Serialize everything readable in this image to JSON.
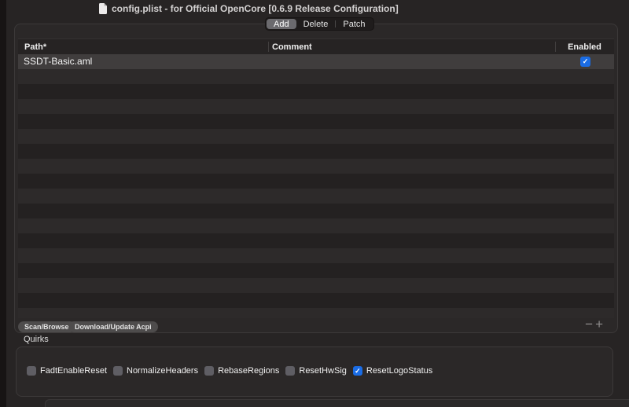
{
  "window": {
    "title": "config.plist - for Official OpenCore [0.6.9 Release Configuration]"
  },
  "tabs": {
    "items": [
      "Add",
      "Delete",
      "Patch"
    ],
    "selected": "Add"
  },
  "table": {
    "columns": {
      "path": "Path*",
      "comment": "Comment",
      "enabled": "Enabled"
    },
    "rows": [
      {
        "path": "SSDT-Basic.aml",
        "comment": "",
        "enabled": true,
        "selected": true
      }
    ],
    "empty_rows": 17
  },
  "footer": {
    "buttons": [
      {
        "label": "Scan/Browse"
      },
      {
        "label": "Download/Update Acpi"
      }
    ],
    "remove_label": "−",
    "add_label": "+"
  },
  "quirks": {
    "title": "Quirks",
    "items": [
      {
        "label": "FadtEnableReset",
        "checked": false
      },
      {
        "label": "NormalizeHeaders",
        "checked": false
      },
      {
        "label": "RebaseRegions",
        "checked": false
      },
      {
        "label": "ResetHwSig",
        "checked": false
      },
      {
        "label": "ResetLogoStatus",
        "checked": true
      }
    ]
  },
  "glyphs": {
    "check": "✓"
  },
  "colors": {
    "accent_blue": "#1a6ce5",
    "selected_row": "#403d3d",
    "window_bg": "#272424",
    "panel_bg": "#2b2828",
    "row_dark": "#242121",
    "row_medium": "#2d2a2a",
    "segment_selected": "#6b6a6e",
    "checkbox_unchecked": "#5f5e64"
  }
}
